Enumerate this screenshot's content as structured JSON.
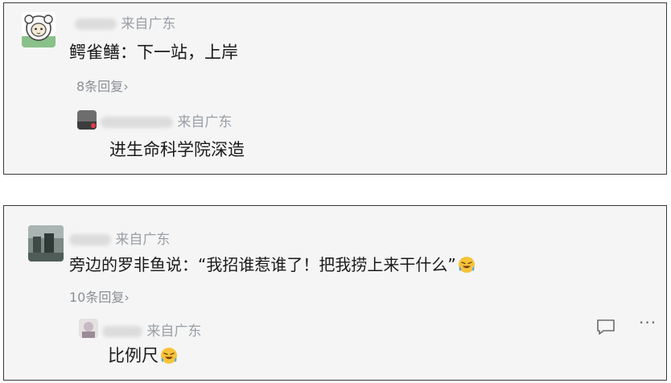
{
  "threads": [
    {
      "comment": {
        "location": "来自广东",
        "text": "鳄雀鳝：下一站，上岸",
        "replies": "8条回复",
        "reply_arrow": "›"
      },
      "reply": {
        "location": "来自广东",
        "text": "进生命科学院深造"
      }
    },
    {
      "comment": {
        "location": "来自广东",
        "text": "旁边的罗非鱼说：“我招谁惹谁了！把我捞上来干什么”",
        "emoji": "laughing-crying-emoji",
        "replies": "10条回复",
        "reply_arrow": "›"
      },
      "reply": {
        "location": "来自广东",
        "text": "比例尺",
        "emoji": "laughing-crying-emoji",
        "actions": {
          "comment_icon": "speech-bubble-icon",
          "more_label": "···"
        }
      }
    }
  ]
}
